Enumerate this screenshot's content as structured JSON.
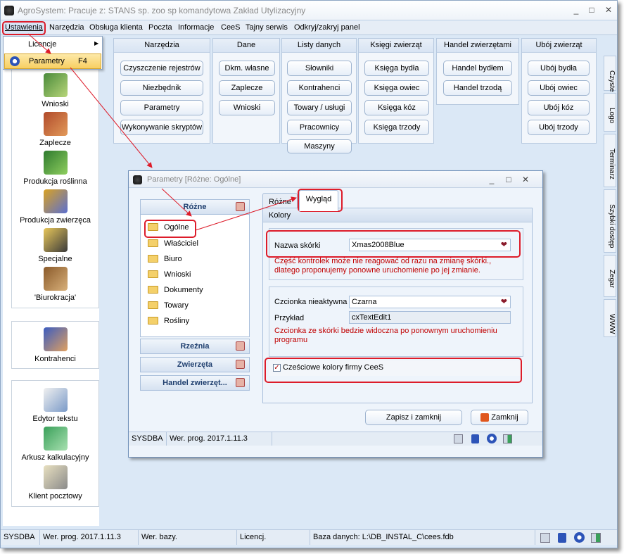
{
  "app": {
    "title": "AgroSystem: Pracuje z: STANS sp. zoo sp komandytowa Zakład Utylizacyjny",
    "window_buttons": [
      "_",
      "□",
      "✕"
    ]
  },
  "menu": [
    "Ustawienia",
    "Narzędzia",
    "Obsługa klienta",
    "Poczta",
    "Informacje",
    "CeeS",
    "Tajny serwis",
    "Odkryj/zakryj panel"
  ],
  "dropdown": {
    "items": [
      {
        "label": "Licencje",
        "arrow": "▶"
      },
      {
        "label": "Parametry",
        "shortcut": "F4"
      }
    ]
  },
  "leftbar": {
    "group1": [
      "Wnioski",
      "Zaplecze",
      "Produkcja roślinna",
      "Produkcja zwierzęca",
      "Specjalne",
      "'Biurokracja'"
    ],
    "group2": [
      "Kontrahenci"
    ],
    "group3": [
      "Edytor tekstu",
      "Arkusz kalkulacyjny",
      "Klient pocztowy"
    ]
  },
  "toolgroups": [
    {
      "title": "Narzędzia",
      "buttons": [
        "Czyszczenie rejestrów",
        "Niezbędnik",
        "Parametry",
        "Wykonywanie skryptów"
      ]
    },
    {
      "title": "Dane",
      "buttons": [
        "Dkm. własne",
        "Zaplecze",
        "Wnioski"
      ]
    },
    {
      "title": "Listy danych",
      "buttons": [
        "Słowniki",
        "Kontrahenci",
        "Towary / usługi",
        "Pracownicy",
        "Maszyny"
      ]
    },
    {
      "title": "Księgi zwierząt",
      "buttons": [
        "Księga bydła",
        "Księga owiec",
        "Księga kóz",
        "Księga trzody"
      ]
    },
    {
      "title": "Handel zwierzętami",
      "buttons": [
        "Handel bydłem",
        "Handel trzodą"
      ]
    },
    {
      "title": "Ubój zwierząt",
      "buttons": [
        "Ubój bydła",
        "Ubój owiec",
        "Ubój kóz",
        "Ubój trzody"
      ]
    }
  ],
  "right_tabs": [
    "Czyste",
    "Logo",
    "Terminarz",
    "Szybki dostęp",
    "Zegar",
    "WWW"
  ],
  "statusbar": {
    "user": "SYSDBA",
    "version": "Wer. prog. 2017.1.11.3",
    "db_version": "Wer. bazy.",
    "license": "Licencj.",
    "database": "Baza danych: L:\\DB_INSTAL_C\\cees.fdb"
  },
  "dialog": {
    "title": "Parametry [Różne: Ogólne]",
    "nav": {
      "groups": [
        "Różne",
        "Rzeźnia",
        "Zwierzęta",
        "Handel zwierzęt..."
      ],
      "items": [
        "Ogólne",
        "Właściciel",
        "Biuro",
        "Wnioski",
        "Dokumenty",
        "Towary",
        "Rośliny"
      ]
    },
    "tabs": [
      "Różne",
      "Wygląd"
    ],
    "section": "Kolory",
    "skin_label": "Nazwa skórki",
    "skin_value": "Xmas2008Blue",
    "skin_warning": "Część kontrolek może nie reagować od razu na zmianę skórki., dlatego proponujemy ponowne uruchomienie po jej zmianie.",
    "font_label": "Czcionka nieaktywna",
    "font_value": "Czarna",
    "example_label": "Przykład",
    "example_value": "cxTextEdit1",
    "font_warning": "Czcionka ze skórki bedzie widoczna po ponownym uruchomieniu programu",
    "checkbox_label": "Cześciowe kolory firmy CeeS",
    "checkbox_checked": "✓",
    "save_button": "Zapisz i zamknij",
    "close_button": "Zamknij",
    "status_user": "SYSDBA",
    "status_version": "Wer. prog. 2017.1.11.3"
  },
  "colors": {
    "annotation": "#dd1c2a",
    "accent": "#1f3f6f"
  }
}
